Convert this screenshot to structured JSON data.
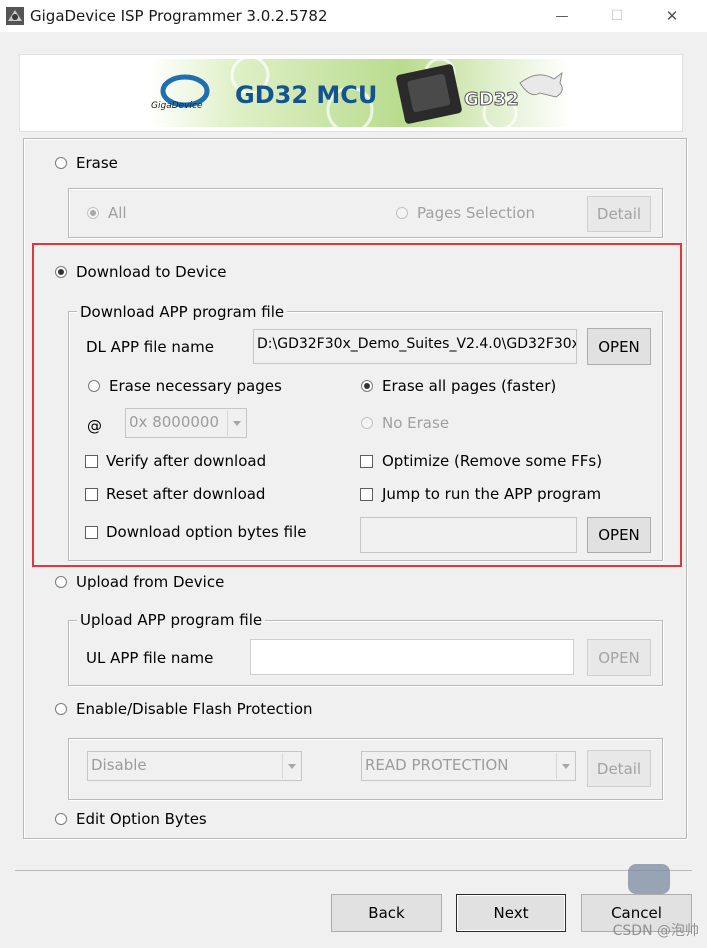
{
  "window": {
    "title": "GigaDevice ISP Programmer 3.0.2.5782",
    "minimize_label": "—",
    "maximize_label": "☐",
    "close_label": "✕"
  },
  "banner": {
    "brand": "GigaDevice",
    "product": "GD32 MCU",
    "chip_mark": "GD32"
  },
  "erase": {
    "label": "Erase",
    "all_label": "All",
    "pages_label": "Pages Selection",
    "detail_label": "Detail"
  },
  "download": {
    "label": "Download to Device",
    "group_title": "Download APP program file",
    "file_label": "DL APP file name",
    "file_value": "D:\\GD32F30x_Demo_Suites_V2.4.0\\GD32F30x",
    "open_label": "OPEN",
    "erase_necessary_label": "Erase necessary pages",
    "erase_all_label": "Erase all pages (faster)",
    "at_label": "@",
    "address_value": "0x 8000000",
    "no_erase_label": "No Erase",
    "verify_label": "Verify after download",
    "optimize_label": "Optimize (Remove some FFs)",
    "reset_label": "Reset after download",
    "jump_label": "Jump to run the APP program",
    "option_bytes_label": "Download option bytes file",
    "option_bytes_value": "",
    "open2_label": "OPEN"
  },
  "upload": {
    "label": "Upload from Device",
    "group_title": "Upload APP program file",
    "file_label": "UL APP file name",
    "file_value": "",
    "open_label": "OPEN"
  },
  "protection": {
    "label": "Enable/Disable Flash Protection",
    "mode_value": "Disable",
    "type_value": "READ PROTECTION",
    "detail_label": "Detail"
  },
  "option_bytes": {
    "label": "Edit Option Bytes"
  },
  "footer": {
    "back_label": "Back",
    "next_label": "Next",
    "cancel_label": "Cancel",
    "watermark": "CSDN @泡帅"
  }
}
